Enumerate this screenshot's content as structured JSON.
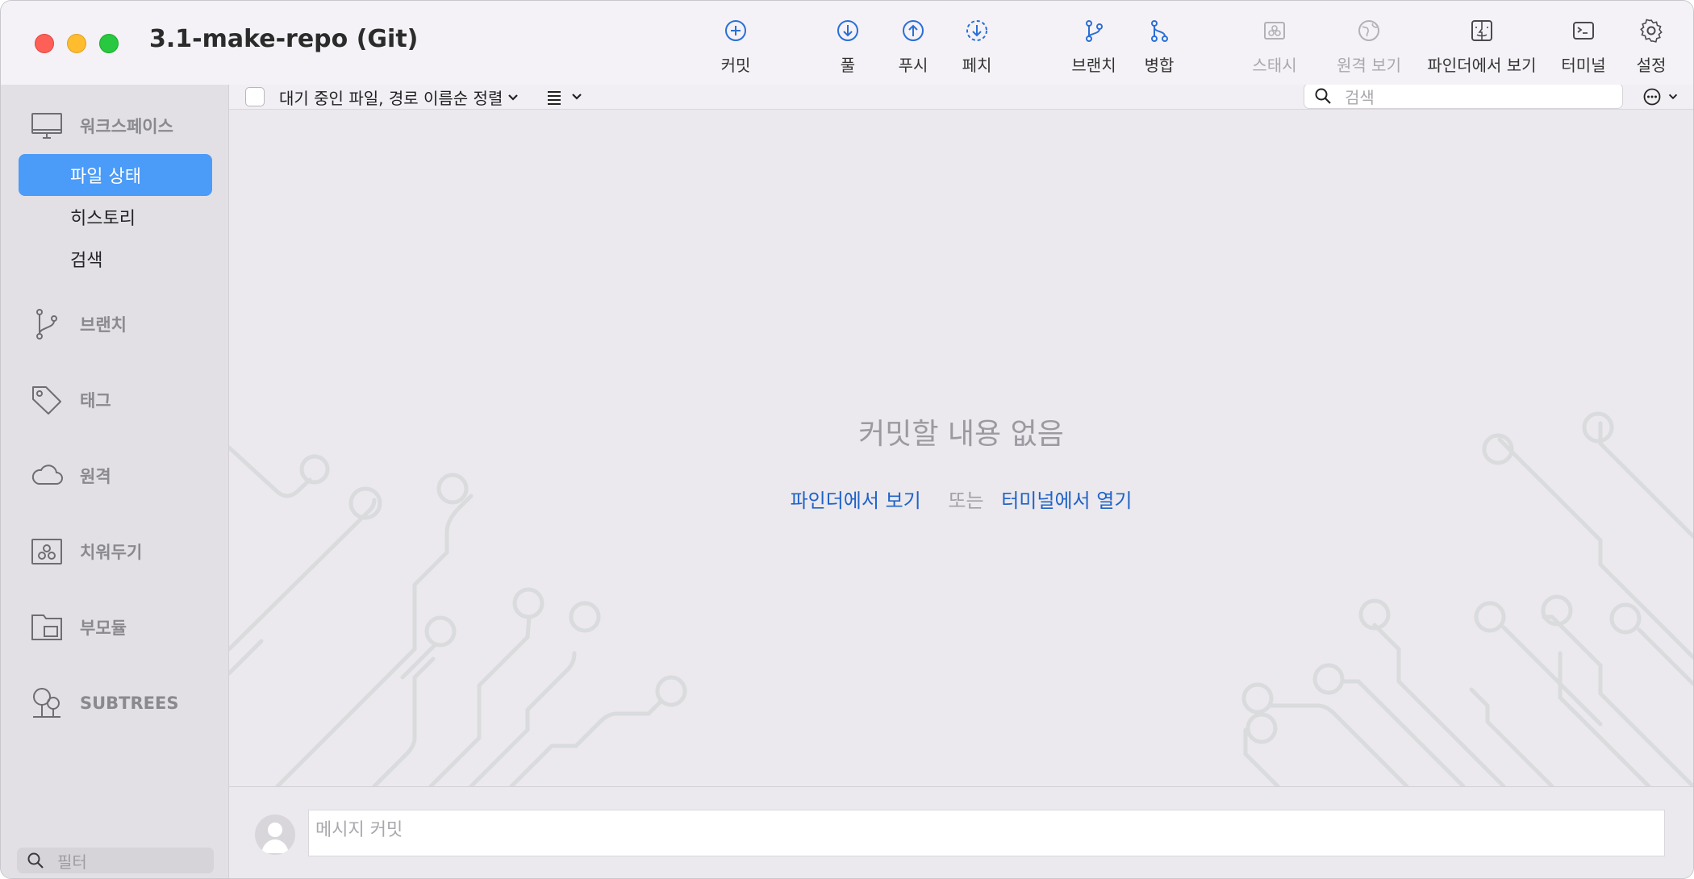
{
  "window": {
    "title": "3.1-make-repo (Git)"
  },
  "toolbar": {
    "items": [
      {
        "id": "commit",
        "label": "커밋"
      },
      {
        "id": "pull",
        "label": "풀"
      },
      {
        "id": "push",
        "label": "푸시"
      },
      {
        "id": "fetch",
        "label": "페치"
      },
      {
        "id": "branch",
        "label": "브랜치"
      },
      {
        "id": "merge",
        "label": "병합"
      },
      {
        "id": "stash",
        "label": "스태시"
      },
      {
        "id": "remote",
        "label": "원격 보기"
      },
      {
        "id": "finder",
        "label": "파인더에서 보기"
      },
      {
        "id": "terminal",
        "label": "터미널"
      },
      {
        "id": "settings",
        "label": "설정"
      }
    ]
  },
  "sidebar": {
    "workspace": "워크스페이스",
    "items": [
      {
        "label": "파일 상태",
        "active": true
      },
      {
        "label": "히스토리",
        "active": false
      },
      {
        "label": "검색",
        "active": false
      }
    ],
    "branches": "브랜치",
    "tags": "태그",
    "remotes": "원격",
    "stashes": "치워두기",
    "submodules": "부모듈",
    "subtrees": "SUBTREES",
    "filter_placeholder": "필터"
  },
  "main": {
    "sort_label": "대기 중인 파일, 경로 이름순 정렬",
    "search_placeholder": "검색",
    "empty_title": "커밋할 내용 없음",
    "link_finder": "파인더에서 보기",
    "or_text": "또는",
    "link_terminal": "터미널에서 열기"
  },
  "commit": {
    "placeholder": "메시지 커밋"
  },
  "colors": {
    "accent": "#4b9bf8",
    "link": "#1f62c9",
    "pattern": "#d9dbdd"
  }
}
